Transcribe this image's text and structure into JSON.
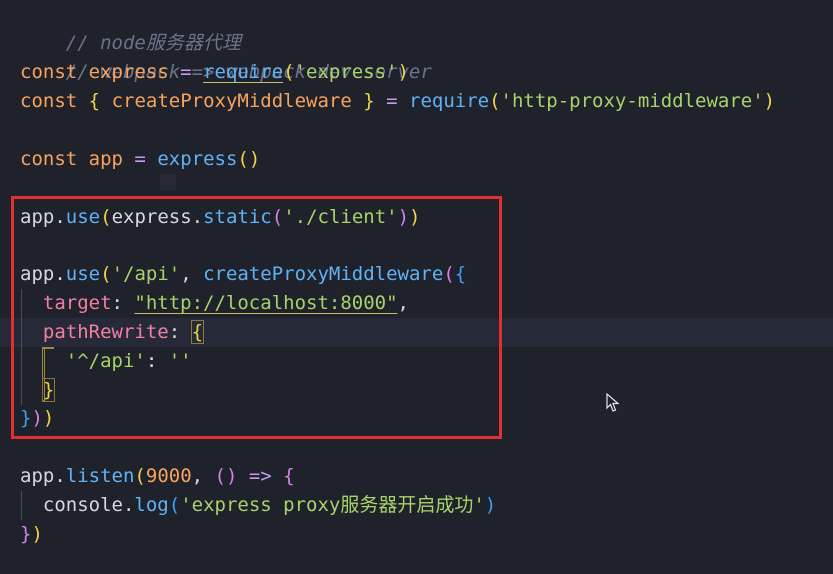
{
  "code": {
    "comment1": "// node服务器代理",
    "comment2": "// webpack => webpack-dev-server",
    "line3": {
      "kw": "const",
      "var": "express",
      "eq": " = ",
      "fn": "require",
      "open": "(",
      "str": "'express'",
      "close": ")"
    },
    "line4": {
      "kw": "const",
      "open": "{",
      "var": "createProxyMiddleware",
      "close": "}",
      "eq": " = ",
      "fn": "require",
      "popen": "(",
      "str": "'http-proxy-middleware'",
      "pclose": ")"
    },
    "line6": {
      "kw": "const",
      "var": "app",
      "eq": " = ",
      "fn": "express",
      "parens": "()"
    },
    "line8": {
      "obj": "app",
      "dot": ".",
      "fn": "use",
      "open": "(",
      "arg": "express",
      "dot2": ".",
      "fn2": "static",
      "open2": "(",
      "str": "'./client'",
      "close2": ")",
      "close": ")"
    },
    "line10": {
      "obj": "app",
      "dot": ".",
      "fn": "use",
      "open": "(",
      "str": "'/api'",
      "comma": ", ",
      "fn2": "createProxyMiddleware",
      "open2": "(",
      "brace": "{"
    },
    "line11": {
      "prop": "target",
      "colon": ": ",
      "str": "\"http://localhost:8000\"",
      "comma": ","
    },
    "line12": {
      "prop": "pathRewrite",
      "colon": ": ",
      "brace": "{"
    },
    "line13": {
      "str": "'^/api'",
      "colon": ": ",
      "str2": "''"
    },
    "line14": {
      "brace": "}"
    },
    "line15": {
      "brace": "}",
      "p1": ")",
      "p2": ")"
    },
    "line17": {
      "obj": "app",
      "dot": ".",
      "fn": "listen",
      "open": "(",
      "num": "9000",
      "comma": ", ",
      "parens": "()",
      "arrow": " => ",
      "brace": "{"
    },
    "line18": {
      "obj": "console",
      "dot": ".",
      "fn": "log",
      "open": "(",
      "str": "'express proxy服务器开启成功'",
      "close": ")"
    },
    "line19": {
      "brace": "}",
      "close": ")"
    }
  },
  "colors": {
    "highlight_box": "#e0302f",
    "background": "#1f212b"
  }
}
